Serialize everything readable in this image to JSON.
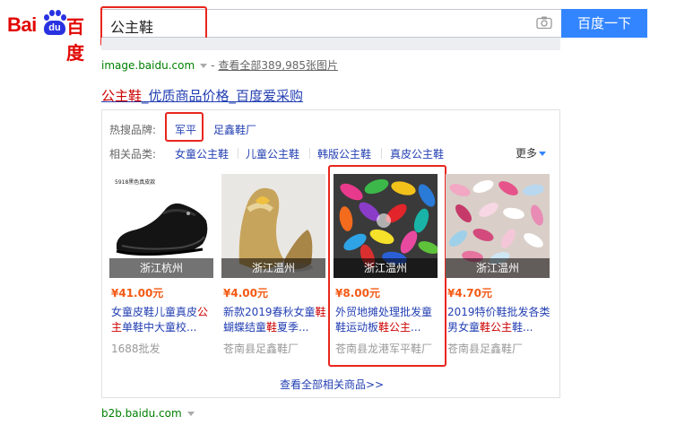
{
  "header": {
    "logo_left": "Bai",
    "logo_paw": "du",
    "logo_right": "百度",
    "query": "公主鞋",
    "search_button": "百度一下"
  },
  "image_result": {
    "url": "image.baidu.com",
    "separator": "-",
    "view_all": "查看全部389,985张图片"
  },
  "result": {
    "title_highlight": "公主鞋",
    "title_rest": "_优质商品价格_百度爱采购"
  },
  "hot_brands": {
    "label": "热搜品牌:",
    "items": [
      "军平",
      "足鑫鞋厂"
    ]
  },
  "categories": {
    "label": "相关品类:",
    "items": [
      "女童公主鞋",
      "儿童公主鞋",
      "韩版公主鞋",
      "真皮公主鞋"
    ],
    "more": "更多"
  },
  "products": [
    {
      "thumb_caption": "5918黑色真皮款",
      "location": "浙江杭州",
      "price": "¥41.00元",
      "title_parts": [
        "女童皮鞋儿童真皮",
        "公主",
        "单鞋中大童校..."
      ],
      "seller": "1688批发"
    },
    {
      "location": "浙江温州",
      "price": "¥4.00元",
      "title_parts": [
        "新款2019春秋女童",
        "鞋",
        "蝴蝶结童",
        "鞋",
        "夏季..."
      ],
      "seller": "苍南县足鑫鞋厂"
    },
    {
      "location": "浙江温州",
      "price": "¥8.00元",
      "title_parts": [
        "外贸地摊处理批发童鞋运动板",
        "鞋公主",
        "..."
      ],
      "seller": "苍南县龙港军平鞋厂"
    },
    {
      "location": "浙江温州",
      "price": "¥4.70元",
      "title_parts": [
        "2019特价鞋批发各类男女童",
        "鞋公主",
        "鞋..."
      ],
      "seller": "苍南县足鑫鞋厂"
    }
  ],
  "view_all_products": "查看全部相关商品>>",
  "b2b_url": "b2b.baidu.com",
  "colors": {
    "brand_red": "#e10602",
    "brand_blue": "#2932e1",
    "link_blue": "#2440b3",
    "price_orange": "#f35a14",
    "url_green": "#008000",
    "annotation_red": "#e8261e",
    "button_blue": "#3385ff"
  }
}
